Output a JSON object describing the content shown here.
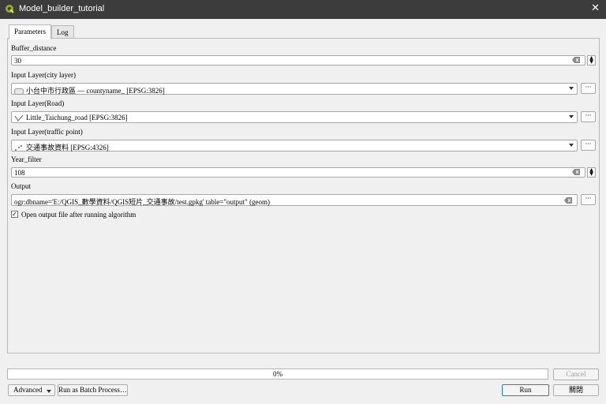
{
  "window": {
    "title": "Model_builder_tutorial",
    "close_glyph": "✕"
  },
  "tabs": [
    {
      "label": "Parameters",
      "active": true
    },
    {
      "label": "Log",
      "active": false
    }
  ],
  "params": {
    "buffer_distance": {
      "label": "Buffer_distance",
      "value": "30"
    },
    "input_city": {
      "label": "Input Layer(city layer)",
      "value": "小台中市行政區 — countyname_ [EPSG:3826]",
      "icon": "polygon-layer-icon"
    },
    "input_road": {
      "label": "Input Layer(Road)",
      "value": "Little_Taichung_road [EPSG:3826]",
      "icon": "line-layer-icon"
    },
    "input_traffic": {
      "label": "Input Layer(traffic point)",
      "value": "交通事故資料 [EPSG:4326]",
      "icon": "point-layer-icon"
    },
    "year_filter": {
      "label": "Year_filter",
      "value": "108"
    },
    "output": {
      "label": "Output",
      "value": "ogr:dbname='E:/QGIS_數學資料/QGIS短片_交通事故/test.gpkg' table=\"output\" (geom)"
    },
    "open_output": {
      "label": "Open output file after running algorithm",
      "checked": true,
      "check_glyph": "✓"
    }
  },
  "progress": {
    "text": "0%",
    "value": 0
  },
  "buttons": {
    "cancel": "Cancel",
    "advanced": "Advanced",
    "batch": "Run as Batch Process…",
    "run": "Run",
    "close": "關閉"
  },
  "glyphs": {
    "dots": "···",
    "spin_up": "▲",
    "spin_down": "▼"
  }
}
